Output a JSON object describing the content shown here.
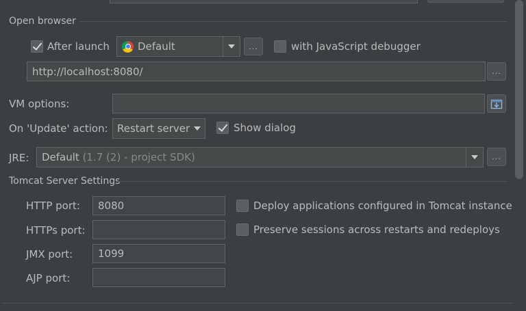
{
  "top": {},
  "open_browser": {
    "title": "Open browser",
    "after_launch_label": "After launch",
    "after_launch_checked": true,
    "browser_value": "Default",
    "with_js_debugger_label": "with JavaScript debugger",
    "with_js_debugger_checked": false,
    "url_value": "http://localhost:8080/",
    "ellipsis": "..."
  },
  "vm_options": {
    "label": "VM options:",
    "value": ""
  },
  "on_update": {
    "label": "On 'Update' action:",
    "value": "Restart server",
    "show_dialog_label": "Show dialog",
    "show_dialog_checked": true
  },
  "jre": {
    "label": "JRE:",
    "value_main": "Default",
    "value_hint": " (1.7 (2) - project SDK)"
  },
  "tomcat": {
    "title": "Tomcat Server Settings",
    "http_port_label": "HTTP port:",
    "http_port_value": "8080",
    "https_port_label": "HTTPs port:",
    "https_port_value": "",
    "jmx_port_label": "JMX port:",
    "jmx_port_value": "1099",
    "ajp_port_label": "AJP port:",
    "ajp_port_value": "",
    "deploy_label": "Deploy applications configured in Tomcat instance",
    "deploy_checked": false,
    "preserve_label": "Preserve sessions across restarts and redeploys",
    "preserve_checked": false
  },
  "colors": {
    "background": "#3c3f41",
    "field": "#45494a",
    "border": "#646464",
    "text": "#bbbbbb"
  }
}
